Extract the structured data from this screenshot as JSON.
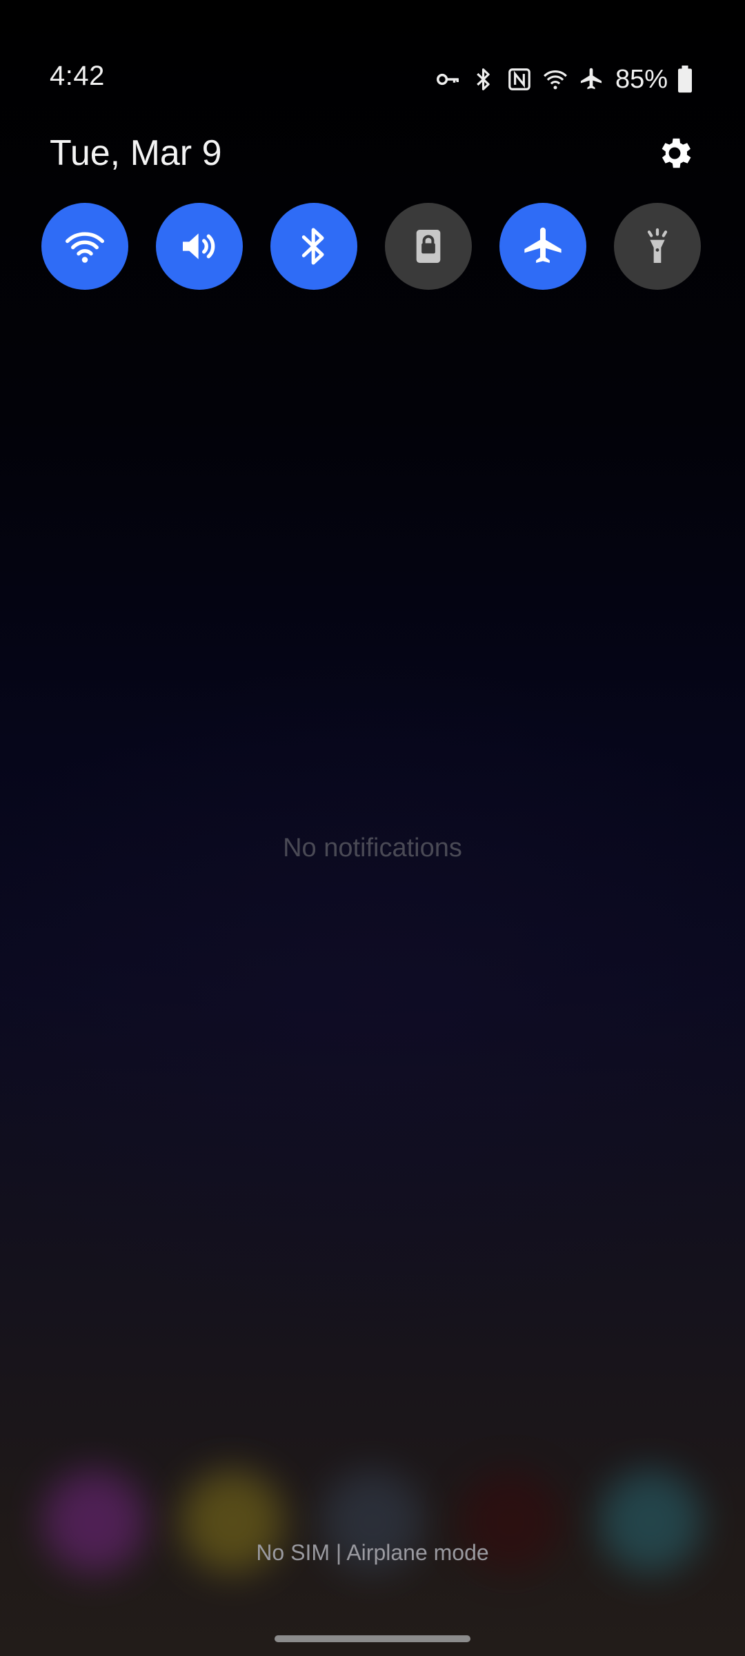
{
  "status_bar": {
    "time": "4:42",
    "battery_percent": "85%",
    "icons": [
      "vpn-key-icon",
      "bluetooth-icon",
      "nfc-icon",
      "wifi-icon",
      "airplane-icon",
      "battery-icon"
    ]
  },
  "header": {
    "date": "Tue, Mar 9",
    "settings_icon": "gear-icon"
  },
  "quick_toggles": [
    {
      "name": "Wi-Fi",
      "icon": "wifi-icon",
      "active": true
    },
    {
      "name": "Sound",
      "icon": "volume-icon",
      "active": true
    },
    {
      "name": "Bluetooth",
      "icon": "bluetooth-icon",
      "active": true
    },
    {
      "name": "Auto rotate lock",
      "icon": "rotation-lock-icon",
      "active": false
    },
    {
      "name": "Airplane mode",
      "icon": "airplane-icon",
      "active": true
    },
    {
      "name": "Flashlight",
      "icon": "flashlight-icon",
      "active": false
    }
  ],
  "notifications": {
    "empty_message": "No notifications"
  },
  "footer": {
    "carrier_text": "No SIM | Airplane mode"
  },
  "colors": {
    "accent_on": "#2f6cf6",
    "tile_off": "#3a3a3a",
    "background": "#000000"
  }
}
